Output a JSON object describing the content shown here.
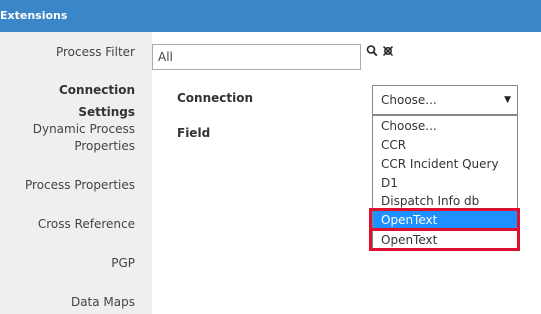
{
  "window": {
    "title": "Extensions"
  },
  "sidebar": {
    "items": [
      {
        "label": "Process Filter"
      },
      {
        "label": "Connection Settings"
      },
      {
        "label": "Dynamic Process"
      },
      {
        "label": "Properties"
      },
      {
        "label": "Process Properties"
      },
      {
        "label": "Cross Reference"
      },
      {
        "label": "PGP"
      },
      {
        "label": "Data Maps"
      }
    ]
  },
  "process_filter": {
    "value": "All",
    "search_icon": "search-icon",
    "clear_icon": "clear-filter-icon"
  },
  "connection": {
    "label": "Connection",
    "selected": "Choose...",
    "options": [
      "Choose...",
      "CCR",
      "CCR Incident Query",
      "D1",
      "Dispatch Info db",
      "OpenText",
      "OpenText"
    ],
    "highlighted_index": 5
  },
  "field": {
    "label": "Field"
  },
  "colors": {
    "header": "#3a86c8",
    "sidebar_bg": "#efefef",
    "highlight": "#1e90ff",
    "annotation": "#e01030"
  }
}
